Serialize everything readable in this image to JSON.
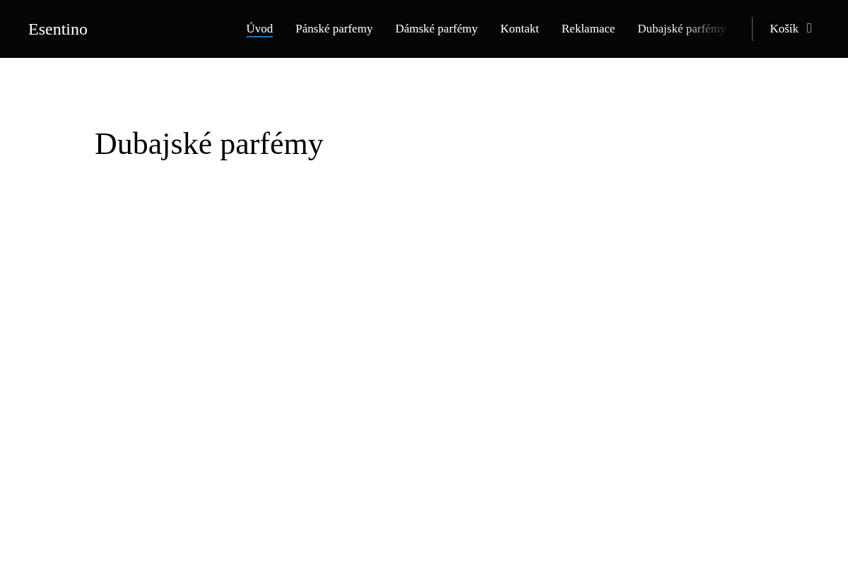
{
  "header": {
    "logo": "Esentino",
    "nav": [
      {
        "label": "Úvod",
        "selected": true,
        "faded": false
      },
      {
        "label": "Pánské parfemy",
        "selected": false,
        "faded": false
      },
      {
        "label": "Dámské parfémy",
        "selected": false,
        "faded": false
      },
      {
        "label": "Kontakt",
        "selected": false,
        "faded": false
      },
      {
        "label": "Reklamace",
        "selected": false,
        "faded": false
      },
      {
        "label": "Dubajské parfémy",
        "selected": false,
        "faded": true
      }
    ],
    "cart": {
      "label": "Košík"
    }
  },
  "page": {
    "title": "Dubajské parfémy"
  }
}
